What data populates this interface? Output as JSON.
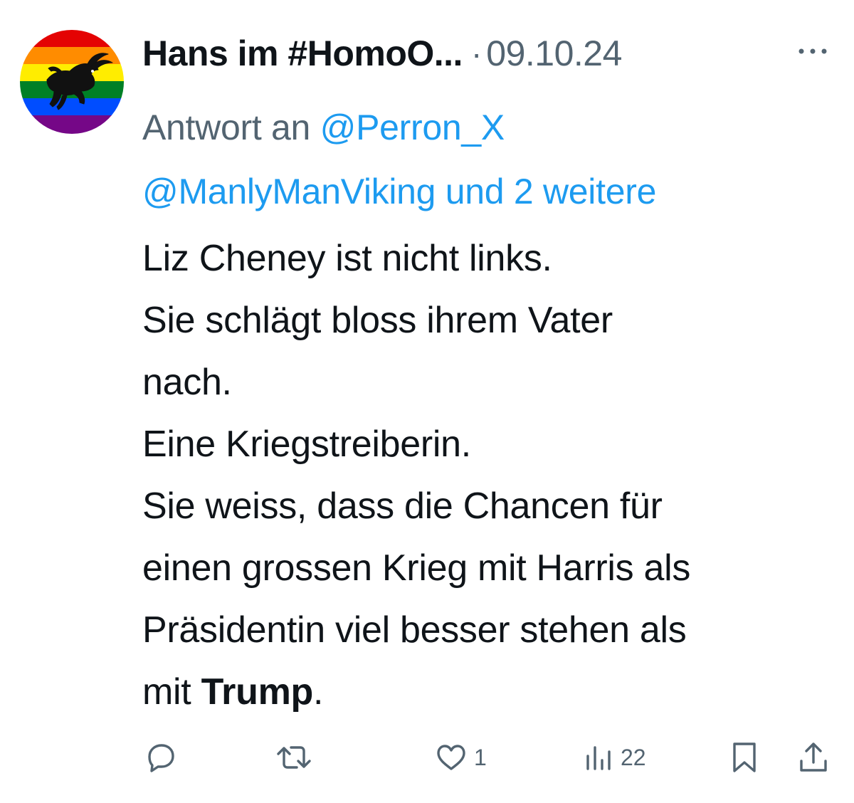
{
  "tweet": {
    "author_display_name": "Hans im #HomoO...",
    "separator": "·",
    "date": "09.10.24",
    "reply_prefix": "Antwort an ",
    "reply_mention_1": "@Perron_X",
    "reply_mention_2": "@ManlyManViking",
    "reply_suffix": " und 2 weitere",
    "body_lines": [
      "Liz Cheney ist nicht links.",
      "Sie schlägt bloss ihrem Vater",
      "nach.",
      "Eine Kriegstreiberin.",
      "Sie weiss, dass die Chancen für",
      "einen grossen Krieg mit Harris als",
      "Präsidentin viel besser stehen als"
    ],
    "last_line_prefix": "mit ",
    "last_line_bold": "Trump",
    "last_line_suffix": "."
  },
  "actions": {
    "reply_icon": "speech-bubble-icon",
    "retweet_icon": "retweet-icon",
    "like_icon": "heart-icon",
    "like_count": "1",
    "views_icon": "bar-chart-icon",
    "views_count": "22",
    "bookmark_icon": "bookmark-icon",
    "share_icon": "share-icon"
  },
  "avatar": {
    "description_icon": "rainbow-ibex-avatar",
    "rainbow_colors": [
      "#e40303",
      "#ff8c00",
      "#ffed00",
      "#008026",
      "#004dff",
      "#750787"
    ]
  },
  "colors": {
    "text_primary": "#0f1419",
    "text_secondary": "#536471",
    "link": "#1d9bf0"
  }
}
